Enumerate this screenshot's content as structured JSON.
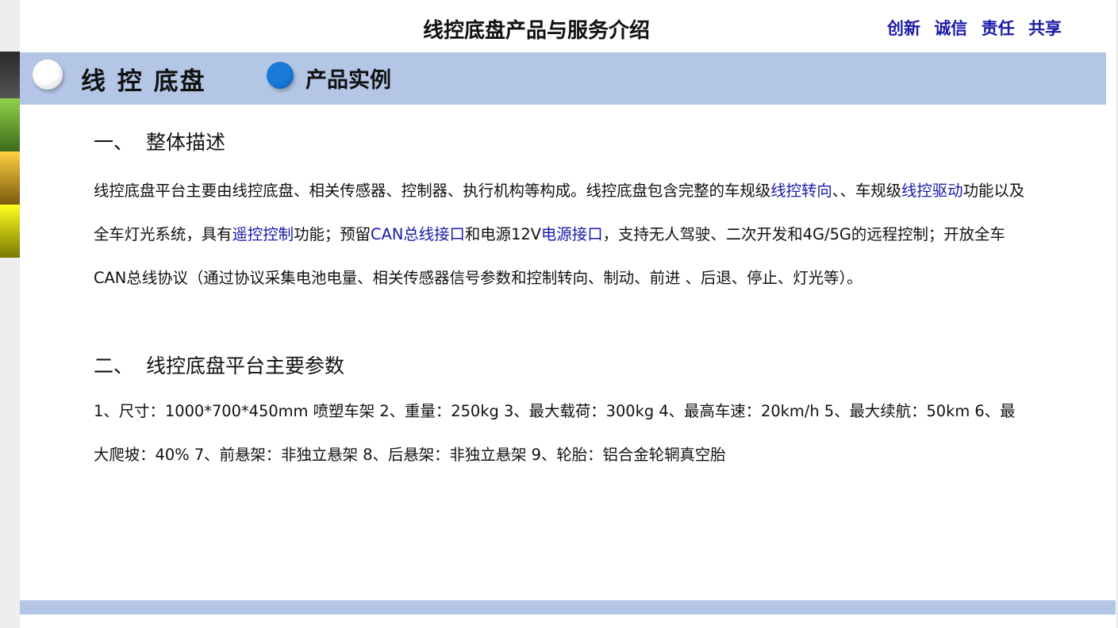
{
  "header": {
    "title": "线控底盘产品与服务介绍",
    "slogans": [
      "创新",
      "诚信",
      "责任",
      "共享"
    ]
  },
  "banner": {
    "title": "线 控 底盘",
    "subtitle": "产品实例"
  },
  "sections": [
    {
      "number": "一、",
      "heading": "整体描述"
    },
    {
      "number": "二、",
      "heading": "线控底盘平台主要参数"
    }
  ],
  "description": {
    "t1": "线控底盘平台主要由线控底盘、相关传感器、控制器、执行机构等构成。线控底盘包含完整的车规级",
    "l1": "线控转向",
    "t2": "、、车规级",
    "l2": "线控驱动",
    "t3": "功能以及全车灯光系统，具有",
    "l3": "遥控控制",
    "t4": "功能；预留",
    "l4": "CAN总线接口",
    "t5": "和电源12V",
    "l5": "电源接口",
    "t6": "，支持无人驾驶、二次开发和4G/5G的远程控制；开放全车CAN总线协议（通过协议采集电池电量、相关传感器信号参数和控制转向、制动、前进 、后退、停止、灯光等）。"
  },
  "params": "1、尺寸：1000*700*450mm 喷塑车架  2、重量：250kg  3、最大载荷：300kg 4、最高车速：20km/h 5、最大续航：50km  6、最大爬坡：40%  7、前悬架：非独立悬架  8、后悬架：非独立悬架  9、轮胎：铝合金轮辋真空胎",
  "colors": {
    "banner_bg": "#b4c6e6",
    "link": "#1a1aa8",
    "accent_circle": "#1a7ad8"
  }
}
